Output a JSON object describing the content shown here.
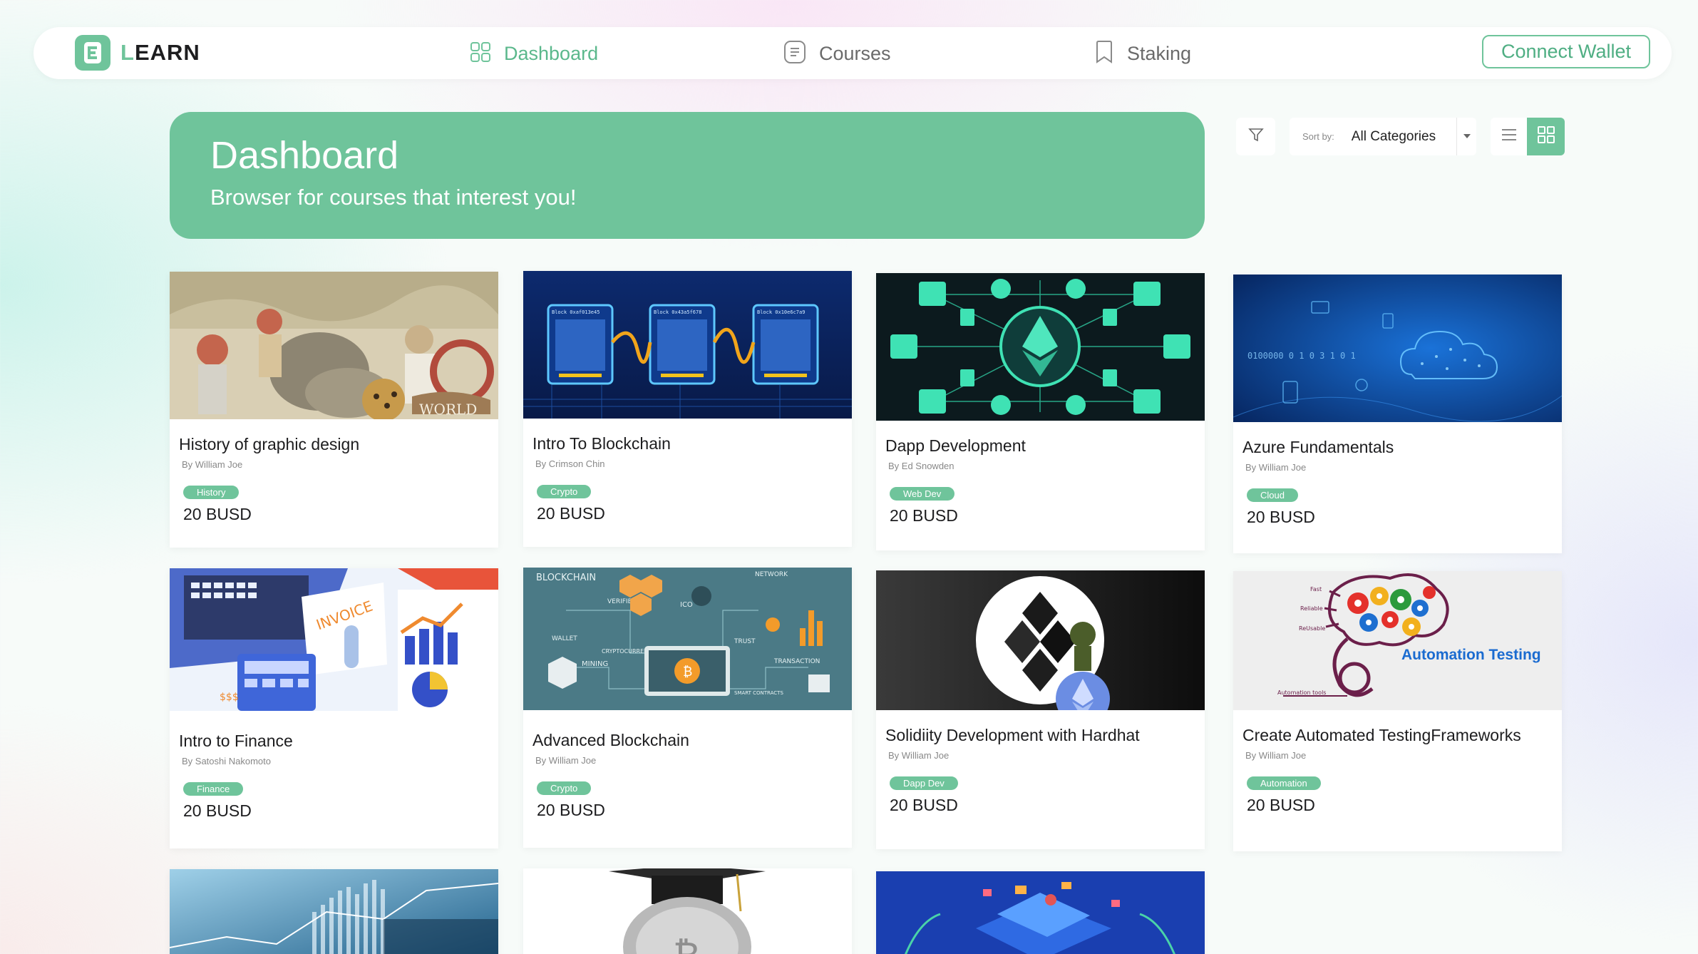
{
  "brand": {
    "name": "LEARN",
    "accent_letter": "L",
    "rest": "EARN",
    "color": "#6fc49b"
  },
  "nav": {
    "dashboard": "Dashboard",
    "courses": "Courses",
    "staking": "Staking",
    "connect_wallet": "Connect Wallet",
    "active": "dashboard"
  },
  "hero": {
    "title": "Dashboard",
    "subtitle": "Browser for courses that interest you!"
  },
  "controls": {
    "sort_label": "Sort by:",
    "sort_value": "All Categories",
    "view_mode": "grid"
  },
  "courses": [
    {
      "title": "History of graphic design",
      "author": "By William Joe",
      "tag": "History",
      "price": "20 BUSD"
    },
    {
      "title": "Intro To Blockchain",
      "author": "By Crimson Chin",
      "tag": "Crypto",
      "price": "20 BUSD"
    },
    {
      "title": "Dapp Development",
      "author": "By Ed Snowden",
      "tag": "Web Dev",
      "price": "20 BUSD"
    },
    {
      "title": "Azure Fundamentals",
      "author": "By William Joe",
      "tag": "Cloud",
      "price": "20 BUSD"
    },
    {
      "title": "Intro to Finance",
      "author": "By Satoshi Nakomoto",
      "tag": "Finance",
      "price": "20 BUSD"
    },
    {
      "title": "Advanced Blockchain",
      "author": "By William Joe",
      "tag": "Crypto",
      "price": "20 BUSD"
    },
    {
      "title": "Solidiity Development with Hardhat",
      "author": "By William Joe",
      "tag": "Dapp Dev",
      "price": "20 BUSD"
    },
    {
      "title": "Create Automated TestingFrameworks",
      "author": "By William Joe",
      "tag": "Automation",
      "price": "20 BUSD"
    }
  ],
  "thumb_text": {
    "world": "WORLD",
    "blocks": [
      "Block 0xaf013e45",
      "Block 0x43a5f678",
      "Block 0x10e6c7a9"
    ],
    "invoice": "INVOICE",
    "dollars": "$$$",
    "blockchain_words": [
      "BLOCKCHAIN",
      "VERIFIED",
      "ICO",
      "NETWORK",
      "WALLET",
      "CRYPTOCURRENCY",
      "TRUST",
      "MINING",
      "TRANSACTION",
      "SMART CONTRACTS"
    ],
    "automation": [
      "Fast",
      "Reliable",
      "ReUsable",
      "Automation tools",
      "Automation Testing"
    ],
    "azure_stream": "0100000  0 1 0 3 1 0 1"
  }
}
